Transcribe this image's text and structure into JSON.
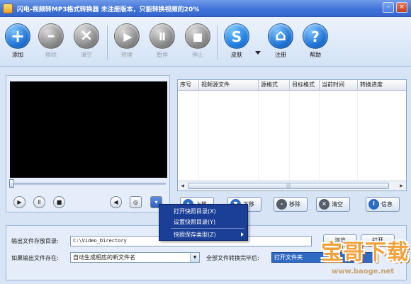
{
  "window": {
    "title": "闪电-视频转MP3格式转换器 未注册版本，只能转换视频的20%",
    "minimize": "–",
    "close": "×"
  },
  "toolbar": {
    "items": [
      {
        "label": "添加",
        "icon": "plus-icon",
        "glyph": "+",
        "enabled": true
      },
      {
        "label": "移除",
        "icon": "minus-icon",
        "glyph": "–",
        "enabled": false
      },
      {
        "label": "清空",
        "icon": "clear-icon",
        "glyph": "×",
        "enabled": false
      },
      {
        "label": "转换",
        "icon": "play-icon",
        "glyph": "▶",
        "enabled": false
      },
      {
        "label": "暂停",
        "icon": "pause-icon",
        "glyph": "Ⅱ",
        "enabled": false
      },
      {
        "label": "停止",
        "icon": "stop-icon",
        "glyph": "■",
        "enabled": false
      },
      {
        "label": "皮肤",
        "icon": "skin-icon",
        "glyph": "S",
        "enabled": true
      },
      {
        "label": "注册",
        "icon": "home-icon",
        "glyph": "⌂",
        "enabled": true
      },
      {
        "label": "帮助",
        "icon": "help-icon",
        "glyph": "?",
        "enabled": true
      }
    ]
  },
  "player": {
    "buttons": [
      {
        "name": "play",
        "glyph": "▶"
      },
      {
        "name": "pause",
        "glyph": "Ⅱ"
      },
      {
        "name": "stop",
        "glyph": "■"
      },
      {
        "name": "volume",
        "glyph": "◀"
      },
      {
        "name": "snapshot",
        "glyph": "◎"
      },
      {
        "name": "folder",
        "glyph": "▾"
      }
    ]
  },
  "table": {
    "columns": [
      "序号",
      "视频源文件",
      "源格式",
      "目标格式",
      "当前时间",
      "转换进度"
    ],
    "rows": [],
    "scroll_grip": "|||"
  },
  "list_buttons": {
    "move_up": "上移",
    "move_down": "下移",
    "remove": "移除",
    "clear": "清空",
    "info": "信息"
  },
  "context_menu": {
    "items": [
      "打开快照目录(X)",
      "设置快照目录(Y)",
      "快照保存类型(Z)"
    ]
  },
  "settings": {
    "output_dir_label": "输出文件存放目录:",
    "output_dir_value": "C:\\Video_Directory",
    "browse_button": "浏览",
    "open_button": "打开",
    "exists_label": "如果输出文件存在:",
    "exists_value": "自动生成相应的新文件名",
    "after_label": "全部文件转换完毕后:",
    "after_value": "打开文件夹"
  },
  "watermark": {
    "logo": "宝哥下载",
    "url": "www.baoge.net"
  }
}
